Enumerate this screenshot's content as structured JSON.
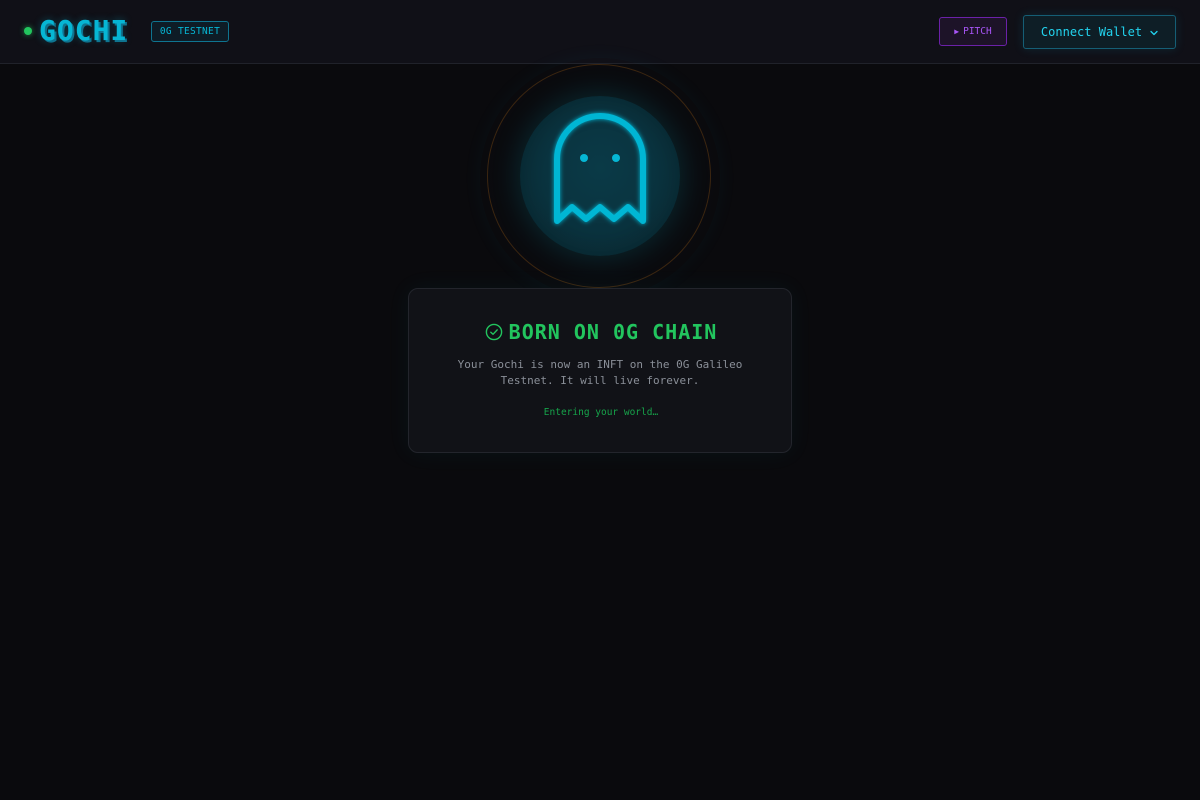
{
  "header": {
    "brand": "GOCHI",
    "network_badge": "0G TESTNET",
    "pitch_label": "PITCH",
    "pitch_icon": "play-icon",
    "wallet_label": "Connect Wallet",
    "wallet_icon": "chevron-down-icon"
  },
  "hero": {
    "icon": "ghost-icon"
  },
  "card": {
    "title": "BORN ON 0G CHAIN",
    "title_icon": "check-circle-icon",
    "description": "Your Gochi is now an INFT on the 0G Galileo Testnet. It will live forever.",
    "status": "Entering your world…"
  },
  "colors": {
    "accent_cyan": "#06b6d4",
    "success_green": "#22c55e",
    "pitch_purple": "#a855f7",
    "background": "#0a0a0d"
  }
}
